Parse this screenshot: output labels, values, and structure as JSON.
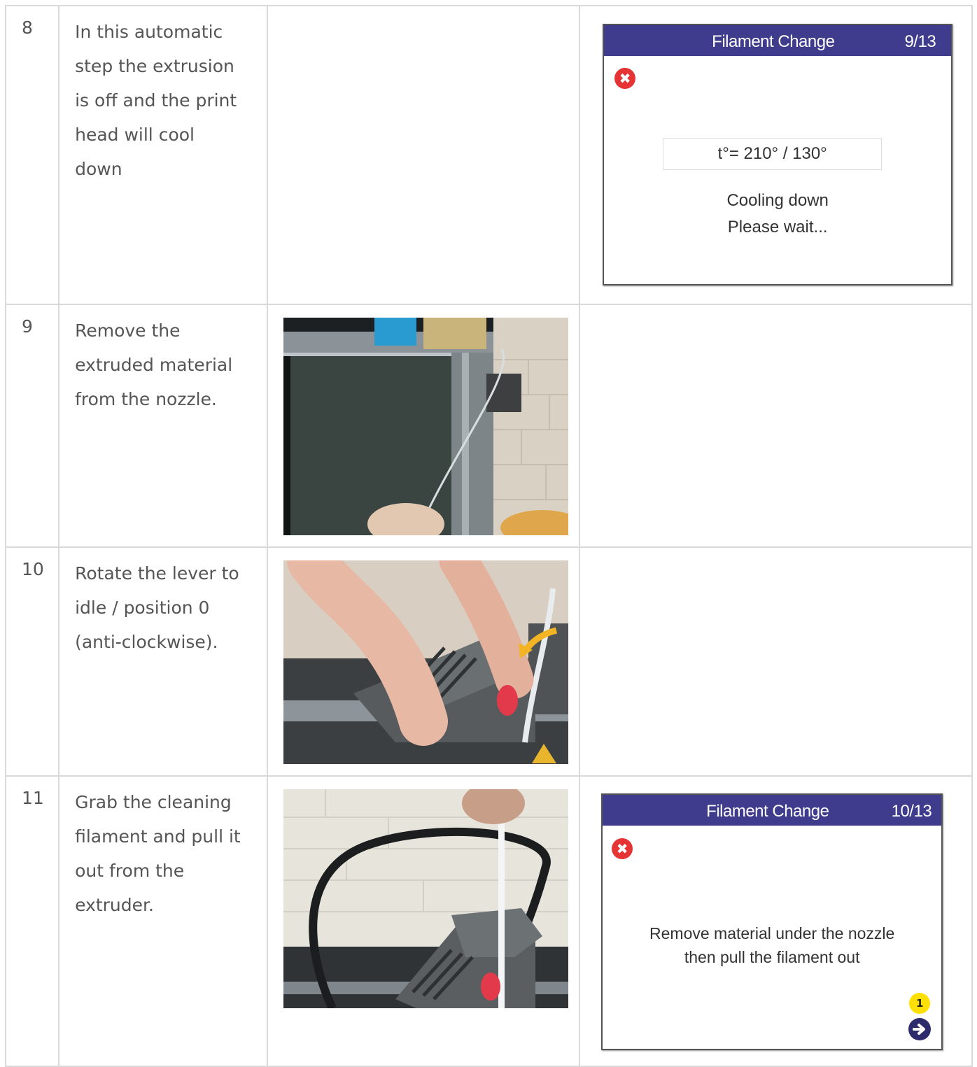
{
  "rows": [
    {
      "step": "8",
      "lines": [
        "In this automatic",
        "step the extrusion",
        "is off and the print",
        "head will cool",
        "down"
      ]
    },
    {
      "step": "9",
      "lines": [
        "Remove the",
        "extruded material",
        "from the nozzle."
      ]
    },
    {
      "step": "10",
      "lines": [
        "Rotate the lever to",
        "idle / position 0",
        "(anti-clockwise)."
      ]
    },
    {
      "step": "11",
      "lines": [
        "Grab the cleaning",
        "filament and pull it",
        "out from the",
        "extruder."
      ]
    }
  ],
  "screen1": {
    "title": "Filament Change",
    "step": "9/13",
    "close_icon": "✖",
    "temperature": "t°= 210° / 130°",
    "message_line1": "Cooling down",
    "message_line2": "Please wait..."
  },
  "screen2": {
    "title": "Filament Change",
    "step": "10/13",
    "close_icon": "✖",
    "message_line1": "Remove material under the nozzle",
    "message_line2": "then pull the filament out",
    "badge": "1"
  },
  "colors": {
    "lcd_header": "#3f3b8d",
    "close_red": "#e63434",
    "badge_yellow": "#ffe000",
    "grid_border": "#d9d9d9"
  }
}
